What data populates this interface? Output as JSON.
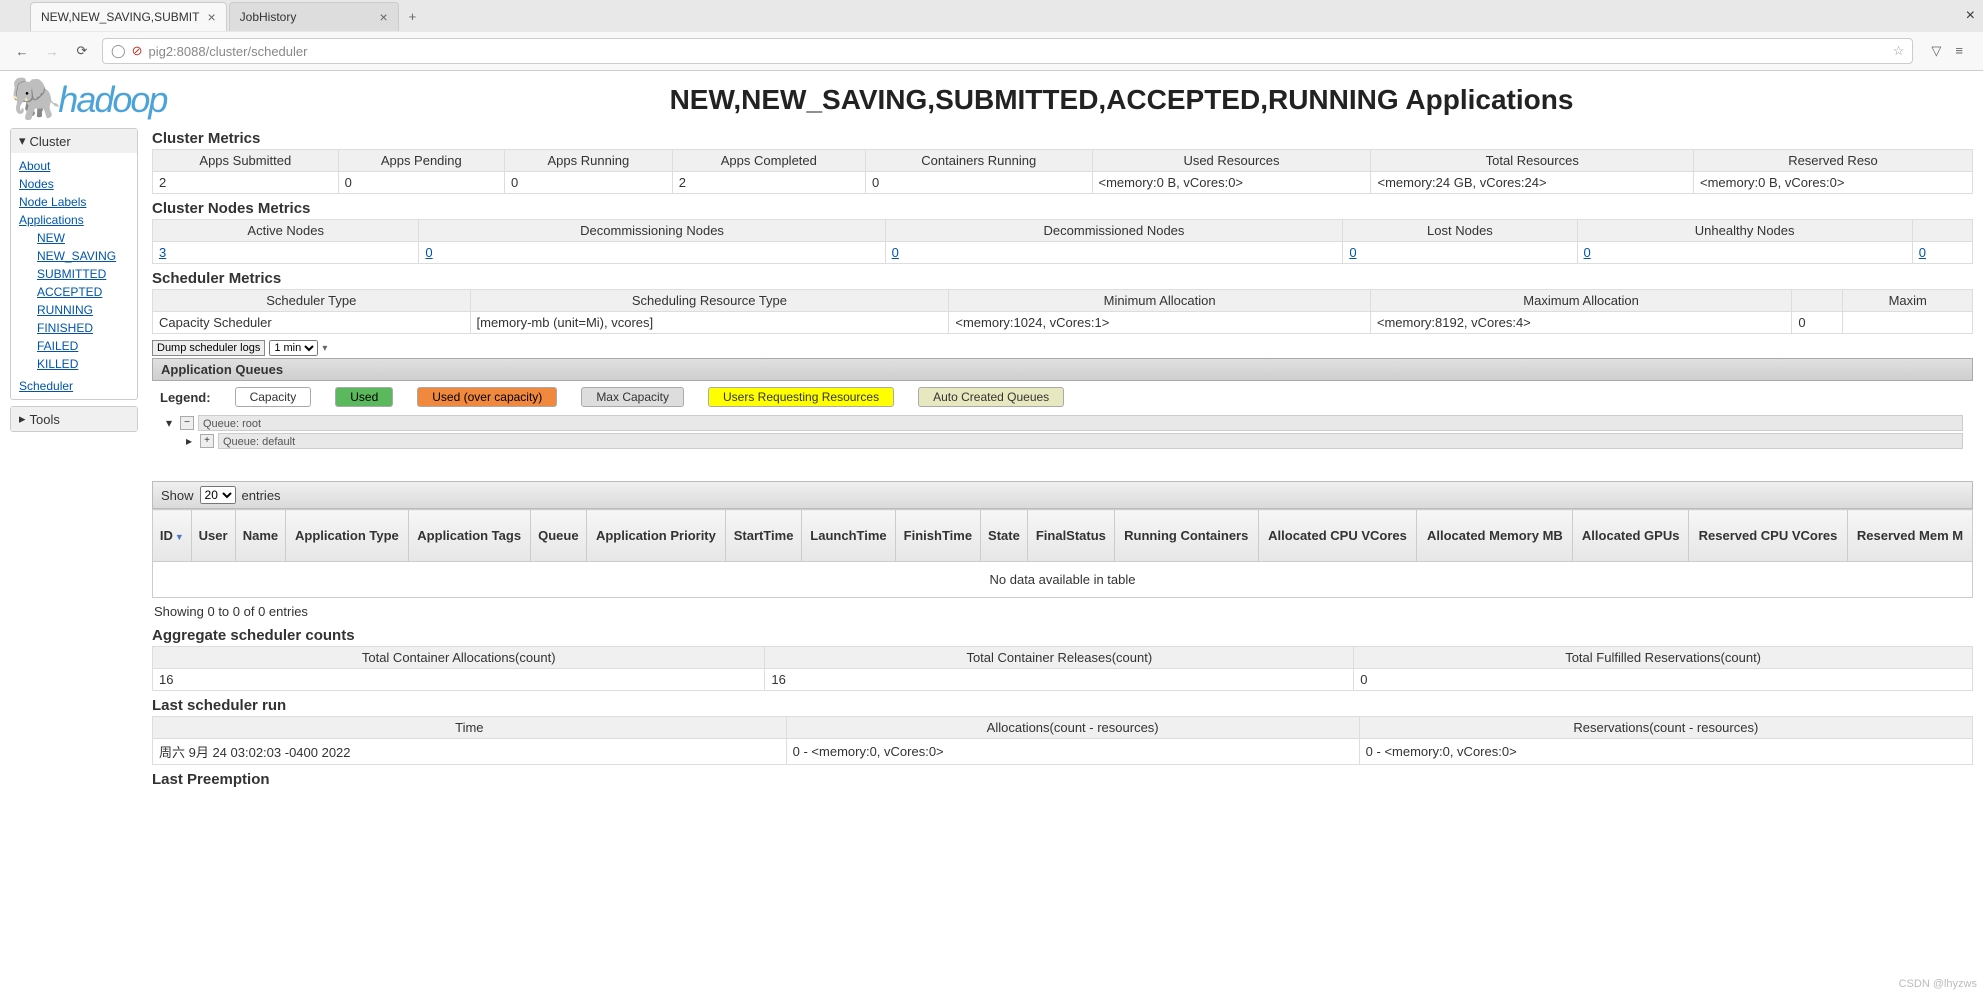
{
  "browser": {
    "tab1": "NEW,NEW_SAVING,SUBMIT",
    "tab2": "JobHistory",
    "url": "pig2:8088/cluster/scheduler"
  },
  "page_title": "NEW,NEW_SAVING,SUBMITTED,ACCEPTED,RUNNING Applications",
  "sidebar": {
    "cluster_hdr": "Cluster",
    "about": "About",
    "nodes": "Nodes",
    "node_labels": "Node Labels",
    "applications": "Applications",
    "app_states": [
      "NEW",
      "NEW_SAVING",
      "SUBMITTED",
      "ACCEPTED",
      "RUNNING",
      "FINISHED",
      "FAILED",
      "KILLED"
    ],
    "scheduler": "Scheduler",
    "tools_hdr": "Tools"
  },
  "cluster_metrics": {
    "title": "Cluster Metrics",
    "headers": [
      "Apps Submitted",
      "Apps Pending",
      "Apps Running",
      "Apps Completed",
      "Containers Running",
      "Used Resources",
      "Total Resources",
      "Reserved Reso"
    ],
    "values": [
      "2",
      "0",
      "0",
      "2",
      "0",
      "<memory:0 B, vCores:0>",
      "<memory:24 GB, vCores:24>",
      "<memory:0 B, vCores:0>"
    ]
  },
  "nodes_metrics": {
    "title": "Cluster Nodes Metrics",
    "headers": [
      "Active Nodes",
      "Decommissioning Nodes",
      "Decommissioned Nodes",
      "Lost Nodes",
      "Unhealthy Nodes",
      ""
    ],
    "values": [
      "3",
      "0",
      "0",
      "0",
      "0",
      "0"
    ]
  },
  "sched_metrics": {
    "title": "Scheduler Metrics",
    "headers": [
      "Scheduler Type",
      "Scheduling Resource Type",
      "Minimum Allocation",
      "Maximum Allocation",
      "",
      "Maxim"
    ],
    "values": [
      "Capacity Scheduler",
      "[memory-mb (unit=Mi), vcores]",
      "<memory:1024, vCores:1>",
      "<memory:8192, vCores:4>",
      "0",
      ""
    ]
  },
  "dump": {
    "btn": "Dump scheduler logs",
    "sel": "1 min"
  },
  "app_queues": {
    "title": "Application Queues",
    "legend": "Legend:",
    "cap": "Capacity",
    "used": "Used",
    "over": "Used (over capacity)",
    "max": "Max Capacity",
    "req": "Users Requesting Resources",
    "auto": "Auto Created Queues",
    "root": "Queue: root",
    "default": "Queue: default"
  },
  "entries": {
    "show": "Show",
    "num": "20",
    "entries": "entries"
  },
  "apps_table": {
    "headers": [
      "ID",
      "User",
      "Name",
      "Application Type",
      "Application Tags",
      "Queue",
      "Application Priority",
      "StartTime",
      "LaunchTime",
      "FinishTime",
      "State",
      "FinalStatus",
      "Running Containers",
      "Allocated CPU VCores",
      "Allocated Memory MB",
      "Allocated GPUs",
      "Reserved CPU VCores",
      "Reserved Mem M"
    ],
    "nodata": "No data available in table"
  },
  "showing_info": "Showing 0 to 0 of 0 entries",
  "agg": {
    "title": "Aggregate scheduler counts",
    "headers": [
      "Total Container Allocations(count)",
      "Total Container Releases(count)",
      "Total Fulfilled Reservations(count)"
    ],
    "values": [
      "16",
      "16",
      "0"
    ]
  },
  "last_run": {
    "title": "Last scheduler run",
    "headers": [
      "Time",
      "Allocations(count - resources)",
      "Reservations(count - resources)"
    ],
    "values": [
      "周六 9月 24 03:02:03 -0400 2022",
      "0 - <memory:0, vCores:0>",
      "0 - <memory:0, vCores:0>"
    ]
  },
  "last_preempt": {
    "title": "Last Preemption"
  },
  "watermark": "CSDN @lhyzws"
}
